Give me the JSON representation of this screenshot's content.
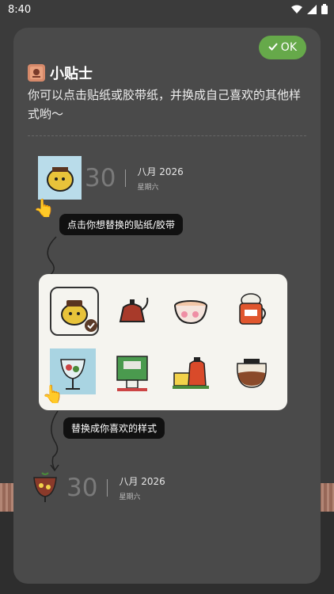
{
  "status_bar": {
    "time": "8:40",
    "icons": [
      "wifi-icon",
      "signal-icon",
      "battery-icon"
    ]
  },
  "dialog": {
    "ok_label": "OK",
    "tip_title": "小贴士",
    "tip_text": "你可以点击贴纸或胶带纸，并换成自己喜欢的其他样式哟～",
    "sample_top": {
      "day": "30",
      "month": "八月 2026",
      "weekday": "星期六"
    },
    "hint_tap": "点击你想替换的贴纸/胶带",
    "hint_replace": "替换成你喜欢的样式",
    "sample_bottom": {
      "day": "30",
      "month": "八月 2026",
      "weekday": "星期六"
    },
    "stickers": [
      "coffee-cup-mascot",
      "red-teapot",
      "pink-teacup",
      "cat-mug",
      "drink-glass",
      "espresso-machine",
      "orange-kettle",
      "glass-coffee-pot"
    ]
  },
  "colors": {
    "ok_green": "#66a94a",
    "sheet": "#4a4a4a",
    "card": "#f5f4ef"
  }
}
